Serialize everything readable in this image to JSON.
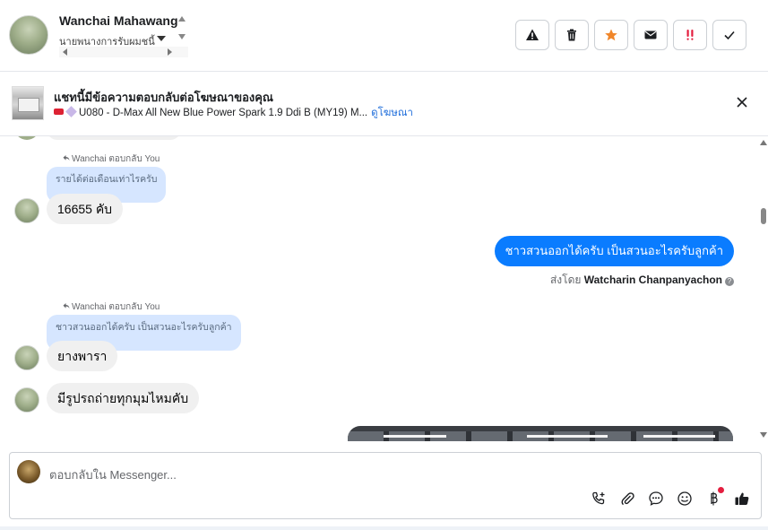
{
  "header": {
    "contact_name": "Wanchai Mahawang",
    "contact_sub": "นายพนางการรับผมชนี้"
  },
  "banner": {
    "title": "แชทนี้มีข้อความตอบกลับต่อโฆษณาของคุณ",
    "ad_text": "U080 - D-Max All New Blue Power Spark 1.9 Ddi B (MY19) M...",
    "link": "ดูโฆษณา"
  },
  "messages": {
    "reply1_meta": "Wanchai ตอบกลับ You",
    "reply1_quote": "รายได้ต่อเดือนเท่าไรครับ",
    "reply1_text": "16655 คับ",
    "out1_text": "ชาวสวนออกได้ครับ เป็นสวนอะไรครับลูกค้า",
    "out1_sent_prefix": "ส่งโดย",
    "out1_sender": "Watcharin Chanpanyachon",
    "reply2_meta": "Wanchai ตอบกลับ You",
    "reply2_quote": "ชาวสวนออกได้ครับ เป็นสวนอะไรครับลูกค้า",
    "reply2_text": "ยางพารา",
    "in3_text": "มีรูปรถถ่ายทุกมุมไหมคับ"
  },
  "composer": {
    "placeholder": "ตอบกลับใน Messenger..."
  },
  "colors": {
    "accent": "#0a7cff",
    "quote_bg": "#d6e6ff",
    "link": "#216fdb"
  }
}
